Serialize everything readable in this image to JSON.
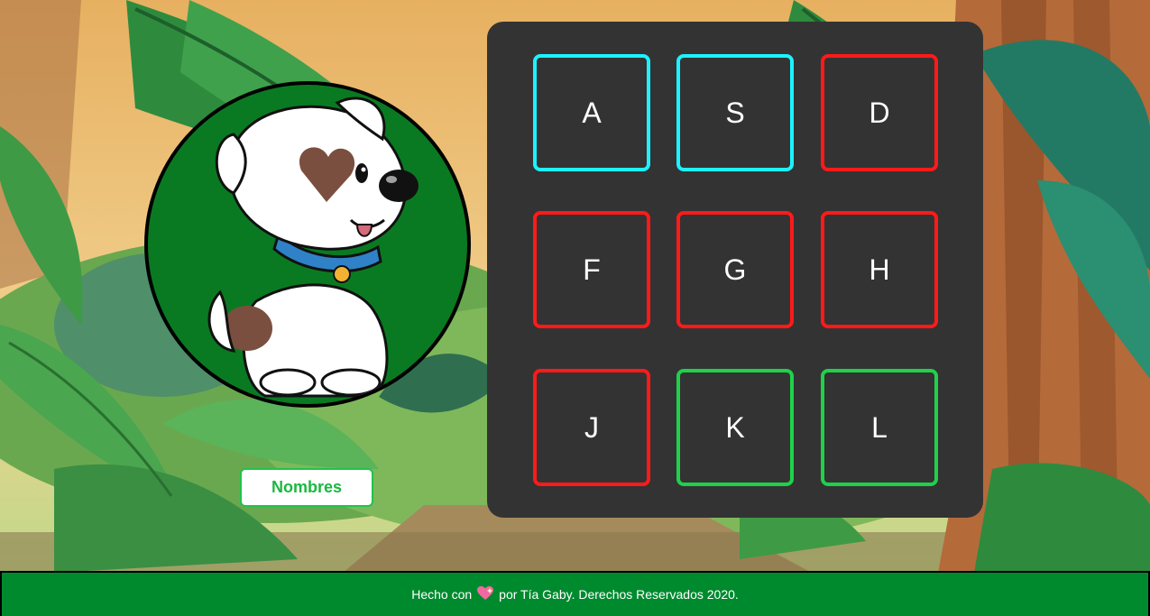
{
  "keys": [
    {
      "label": "A",
      "color": "cyan"
    },
    {
      "label": "S",
      "color": "cyan"
    },
    {
      "label": "D",
      "color": "red"
    },
    {
      "label": "F",
      "color": "red"
    },
    {
      "label": "G",
      "color": "red"
    },
    {
      "label": "H",
      "color": "red"
    },
    {
      "label": "J",
      "color": "red"
    },
    {
      "label": "K",
      "color": "green"
    },
    {
      "label": "L",
      "color": "green"
    }
  ],
  "names_button": {
    "label": "Nombres"
  },
  "footer": {
    "prefix": "Hecho con",
    "heart_icon": "sparkling-heart-icon",
    "suffix": "por Tía Gaby. Derechos Reservados 2020."
  },
  "colors": {
    "cyan": "#1df2ff",
    "red": "#ff1a1a",
    "green": "#1fd14a",
    "panel": "#333333",
    "footer": "#008a2e",
    "dog_circle": "#0a7a22"
  }
}
